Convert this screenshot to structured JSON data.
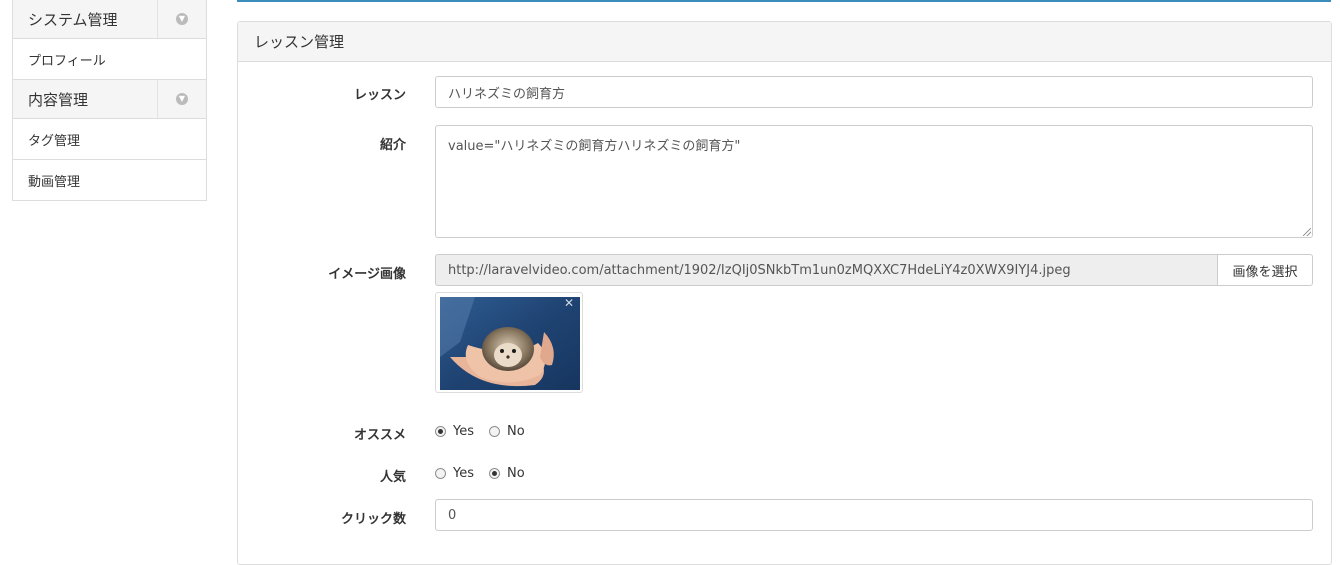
{
  "sidebar": {
    "sections": [
      {
        "title": "システム管理",
        "items": [
          "プロフィール"
        ]
      },
      {
        "title": "内容管理",
        "items": [
          "タグ管理",
          "動画管理"
        ]
      }
    ]
  },
  "panel": {
    "title": "レッスン管理",
    "lesson": {
      "label": "レッスン",
      "value": "ハリネズミの飼育方"
    },
    "intro": {
      "label": "紹介",
      "value": "value=\"ハリネズミの飼育方ハリネズミの飼育方\""
    },
    "image": {
      "label": "イメージ画像",
      "url": "http://laravelvideo.com/attachment/1902/IzQIj0SNkbTm1un0zMQXXC7HdeLiY4z0XWX9IYJ4.jpeg",
      "button": "画像を選択",
      "close_glyph": "✕"
    },
    "recommend": {
      "label": "オススメ",
      "yes": "Yes",
      "no": "No",
      "selected": "yes"
    },
    "popular": {
      "label": "人気",
      "yes": "Yes",
      "no": "No",
      "selected": "no"
    },
    "clicks": {
      "label": "クリック数",
      "value": "0"
    }
  },
  "colors": {
    "accent": "#3c8dbc"
  }
}
